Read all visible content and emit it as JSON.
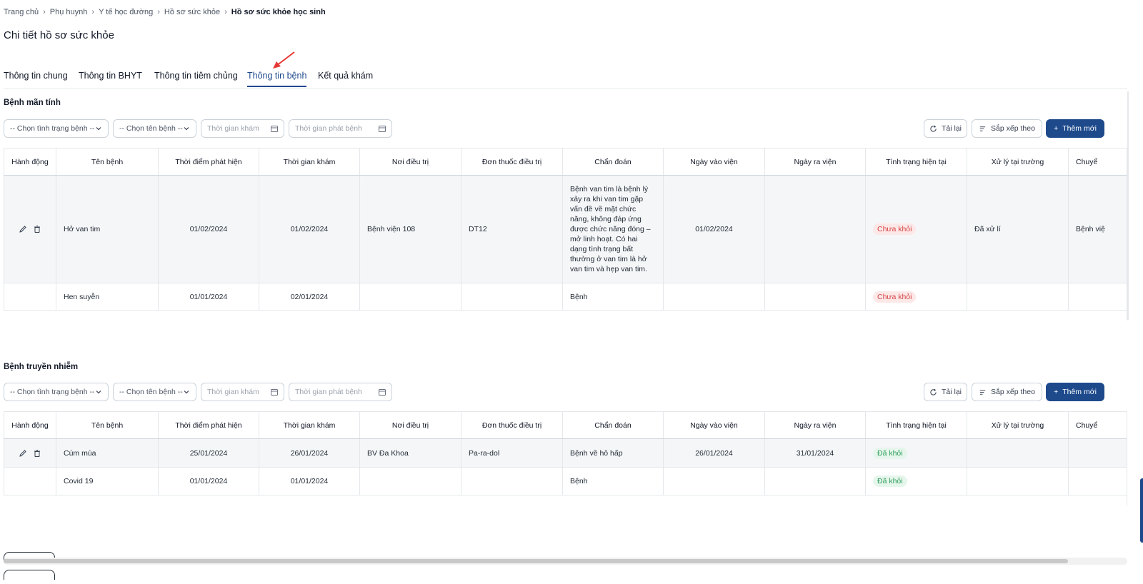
{
  "breadcrumb": [
    "Trang chủ",
    "Phụ huynh",
    "Y tế học đường",
    "Hồ sơ sức khỏe",
    "Hồ sơ sức khỏe học sinh"
  ],
  "page_title": "Chi tiết hồ sơ sức khỏe",
  "tabs": [
    "Thông tin chung",
    "Thông tin BHYT",
    "Thông tin tiêm chủng",
    "Thông tin bệnh",
    "Kết quả khám"
  ],
  "active_tab": "Thông tin bệnh",
  "colors": {
    "primary": "#1e4a8c",
    "annotation_arrow": "#e53935",
    "badge_red_bg": "#fde8e8",
    "badge_red_text": "#d64545",
    "badge_green_bg": "#e6f6ec",
    "badge_green_text": "#2f9e5b"
  },
  "filters": {
    "status_select": "-- Chọn tình trạng bệnh --",
    "name_select": "-- Chọn tên bệnh --",
    "exam_time_placeholder": "Thời gian khám",
    "onset_time_placeholder": "Thời gian phát bệnh"
  },
  "buttons": {
    "reload": "Tải lại",
    "sort": "Sắp xếp theo",
    "add": "Thêm mới"
  },
  "columns": [
    "Hành động",
    "Tên bệnh",
    "Thời điểm phát hiện",
    "Thời gian khám",
    "Nơi điều trị",
    "Đơn thuốc điều trị",
    "Chẩn đoán",
    "Ngày vào viện",
    "Ngày ra viện",
    "Tình trạng hiện tại",
    "Xử lý tại trường",
    "Chuyể"
  ],
  "chronic": {
    "title": "Bệnh mãn tính",
    "rows": [
      {
        "name": "Hở van tim",
        "detected": "01/02/2024",
        "exam": "01/02/2024",
        "place": "Bệnh viện 108",
        "prescription": "DT12",
        "diagnosis": "Bệnh van tim là bệnh lý xảy ra khi van tim gặp vấn đề về mặt chức năng, không đáp ứng được chức năng đóng – mở linh hoạt. Có hai dạng tình trạng bất thường ở van tim là hở van tim và hẹp van tim.",
        "admit": "01/02/2024",
        "discharge": "",
        "status": "Chưa khỏi",
        "school_action": "Đã xử lí",
        "transfer": "Bệnh việ"
      },
      {
        "name": "Hen suyễn",
        "detected": "01/01/2024",
        "exam": "02/01/2024",
        "place": "",
        "prescription": "",
        "diagnosis": "Bệnh",
        "admit": "",
        "discharge": "",
        "status": "Chưa khỏi",
        "school_action": "",
        "transfer": ""
      }
    ]
  },
  "infectious": {
    "title": "Bệnh truyền nhiễm",
    "rows": [
      {
        "name": "Cúm mùa",
        "detected": "25/01/2024",
        "exam": "26/01/2024",
        "place": "BV Đa Khoa",
        "prescription": "Pa-ra-dol",
        "diagnosis": "Bệnh về hô hấp",
        "admit": "26/01/2024",
        "discharge": "31/01/2024",
        "status": "Đã khỏi",
        "school_action": "",
        "transfer": ""
      },
      {
        "name": "Covid 19",
        "detected": "01/01/2024",
        "exam": "01/01/2024",
        "place": "",
        "prescription": "",
        "diagnosis": "Bệnh",
        "admit": "",
        "discharge": "",
        "status": "Đã khỏi",
        "school_action": "",
        "transfer": ""
      }
    ]
  }
}
